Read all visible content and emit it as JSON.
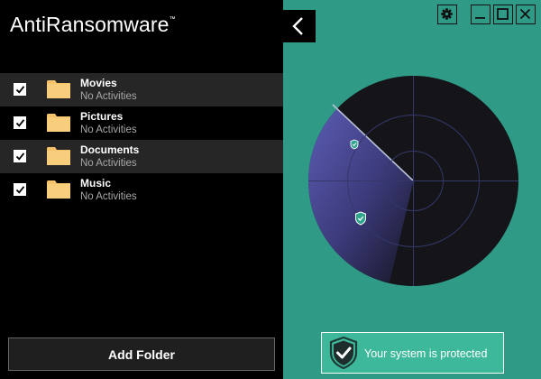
{
  "app": {
    "title": "AntiRansomware",
    "title_mark": "™"
  },
  "folders": [
    {
      "name": "Movies",
      "status": "No Activities",
      "checked": true
    },
    {
      "name": "Pictures",
      "status": "No Activities",
      "checked": true
    },
    {
      "name": "Documents",
      "status": "No Activities",
      "checked": true
    },
    {
      "name": "Music",
      "status": "No Activities",
      "checked": true
    }
  ],
  "actions": {
    "add_folder_label": "Add Folder"
  },
  "header": {
    "back_icon": "chevron-left-icon",
    "settings_icon": "gear-icon",
    "minimize_icon": "minimize-icon",
    "maximize_icon": "maximize-icon",
    "close_icon": "close-icon"
  },
  "status": {
    "message": "Your system is protected",
    "icon": "shield-check-icon"
  },
  "colors": {
    "accent": "#2f9a86",
    "panel": "#000000",
    "radar_sweep": "#5b5ab0",
    "status_bg": "#3db89a"
  }
}
